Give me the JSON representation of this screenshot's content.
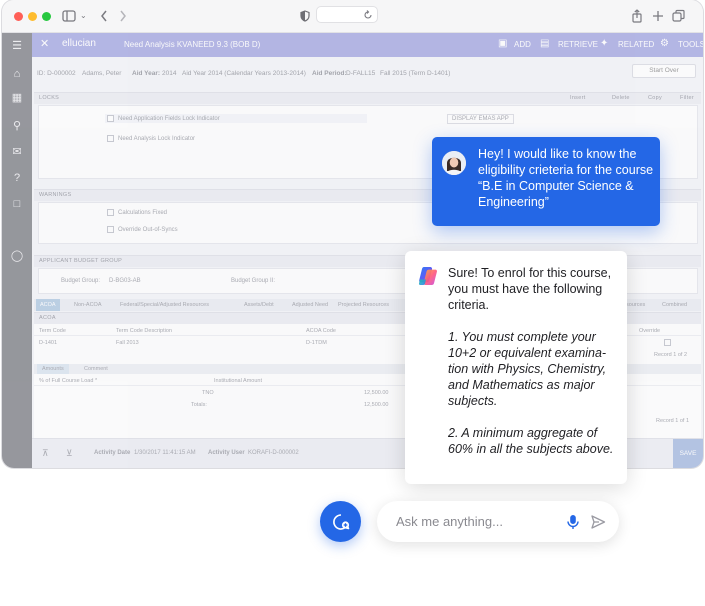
{
  "app": {
    "brand": "ellucian",
    "page_title": "Need Analysis KVANEED 9.3 (BOB D)",
    "menu": [
      "ADD",
      "RETRIEVE",
      "RELATED",
      "TOOLS"
    ],
    "info": {
      "id": "ID: D-000002",
      "name": "Adams, Peter",
      "aid_year_label": "Aid Year:",
      "aid_year": "2014",
      "aid_year_desc": "Aid Year 2014 (Calendar Years 2013-2014)",
      "aid_period_label": "Aid Period:",
      "aid_period": "D-FALL15",
      "aid_period_desc": "Fall 2015 (Term D-1401)"
    },
    "start_over": "Start Over",
    "locks": {
      "title": "LOCKS",
      "opt1": "Need Application Fields Lock Indicator",
      "opt2": "Need Analysis Lock Indicator",
      "btn": "DISPLAY EMAS APP",
      "tools": [
        "Insert",
        "Delete",
        "Copy",
        "Filter"
      ]
    },
    "warnings": {
      "title": "WARNINGS",
      "opt1": "Calculations Fixed",
      "opt2": "Override Out-of-Syncs"
    },
    "budget": {
      "title": "APPLICANT BUDGET GROUP",
      "budget_group_label": "Budget Group:",
      "budget_group": "D-BG03-AB",
      "budget_group2_label": "Budget Group II:"
    },
    "tabs": [
      "ACOA",
      "Non-ACOA",
      "Federal/Special/Adjusted Resources",
      "Assets/Debt",
      "Adjusted Need",
      "Projected Resources",
      "Resources",
      "Combined"
    ],
    "acoa": {
      "title": "ACOA",
      "col_term": "Term Code",
      "col_desc": "Term Code Description",
      "col_acoa": "ACOA Code",
      "col_override": "Override",
      "term": "D-1401",
      "desc": "Fall 2013",
      "code": "D-1TDM",
      "record": "Record 1 of 2",
      "subtabs": [
        "Amounts",
        "Comment"
      ],
      "col_load": "% of Full Course Load *",
      "col_inst": "Institutional Amount",
      "tno": "TNO",
      "amount": "12,500.00",
      "totals_label": "Totals:",
      "totals": "12,500.00",
      "record2": "Record 1 of 1"
    },
    "footer": {
      "activity_date_label": "Activity Date",
      "activity_date": "1/30/2017 11:41:15 AM",
      "activity_user_label": "Activity User",
      "activity_user": "KORAFI-D-000002",
      "save": "SAVE"
    }
  },
  "chat": {
    "user_message": "Hey! I would like to know the eligibility crieteria for the course “B.E in Computer Science & Engineering”",
    "ai_intro": "Sure! To enrol for this course, you must have the following criteria.",
    "ai_point1": "1. You must complete your 10+2 or equivalent examina-tion with Physics, Chemistry, and Mathematics as major subjects.",
    "ai_point2": "2. A minimum aggregate of 60% in all the subjects above.",
    "input_placeholder": "Ask me anything..."
  },
  "icons": {
    "new_chat": "chat-plus-icon",
    "mic": "microphone-icon",
    "send": "send-icon",
    "assistant": "copilot-logo-icon"
  },
  "colors": {
    "accent_blue": "#2467e6",
    "app_header": "#7f83d6",
    "sidebar": "#4a4c55"
  }
}
